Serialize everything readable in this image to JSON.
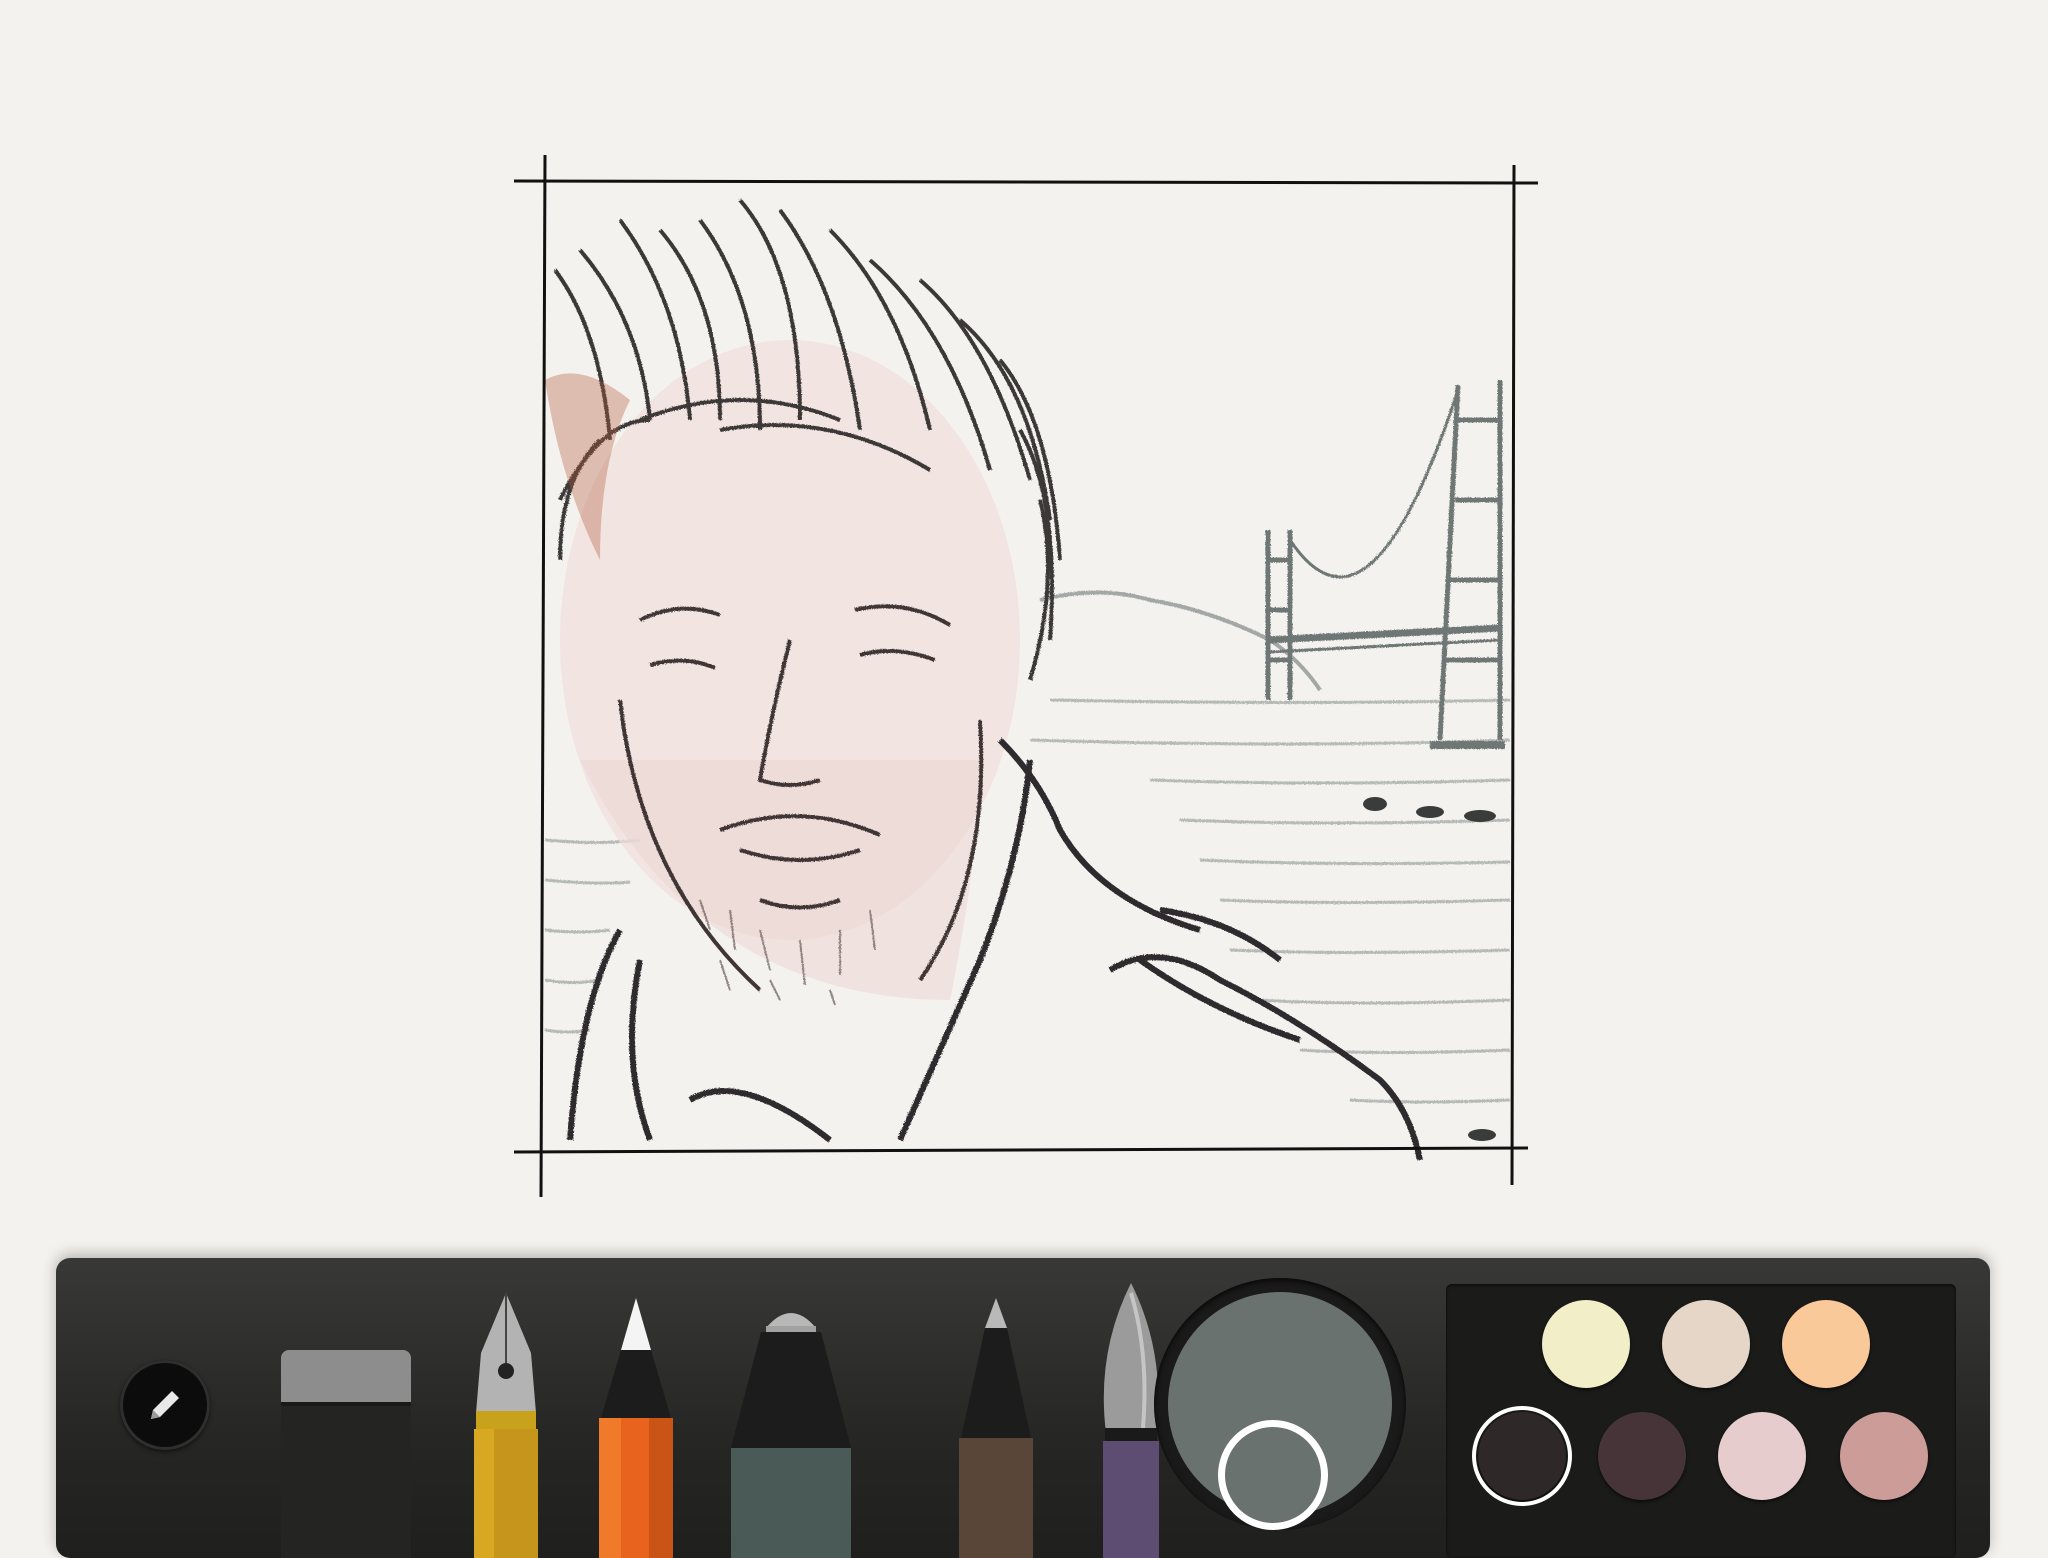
{
  "app": {
    "tools": [
      {
        "name": "eraser",
        "icon": "eraser-icon"
      },
      {
        "name": "fountain-pen",
        "icon": "fountain-pen-icon"
      },
      {
        "name": "pencil",
        "icon": "pencil-icon",
        "selected": true
      },
      {
        "name": "marker",
        "icon": "marker-icon"
      },
      {
        "name": "fineliner",
        "icon": "fineliner-icon"
      },
      {
        "name": "watercolor-brush",
        "icon": "brush-icon"
      }
    ],
    "menu_icon": "pencil-edit-icon"
  },
  "colors": {
    "current": "#6a7270",
    "palette": [
      "#f1eec8",
      "#e6d6c8",
      "#f9c99a",
      "#2f2828",
      "#463438",
      "#e6cccd",
      "#cc9c98"
    ],
    "selected_index": 3
  }
}
